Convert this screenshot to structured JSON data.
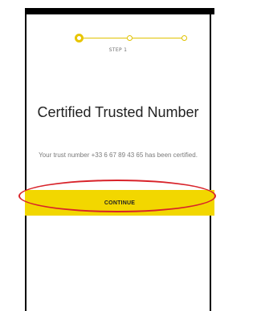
{
  "stepper": {
    "label": "STEP 1",
    "accent": "#e8c500"
  },
  "title": "Certified Trusted Number",
  "description": "Your trust number +33 6 67 89 43 65 has been certified.",
  "continue_button": {
    "label": "CONTINUE",
    "color": "#f2d700"
  },
  "annotation": {
    "color": "#d8232a"
  }
}
